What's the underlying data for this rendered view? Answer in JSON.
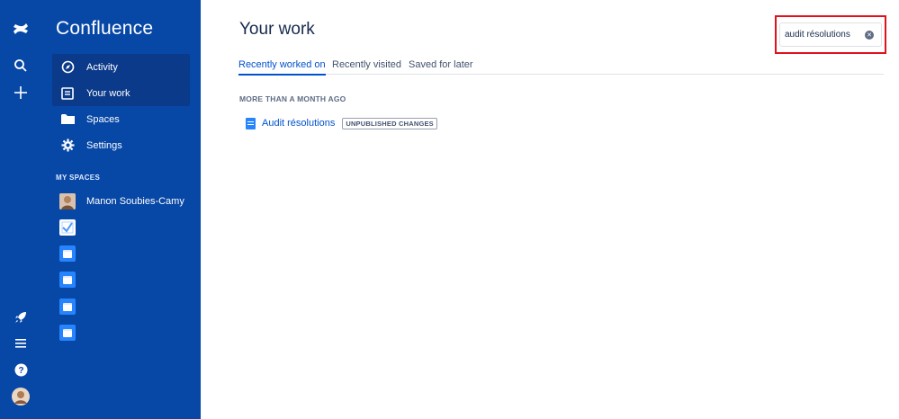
{
  "app": {
    "name": "Confluence"
  },
  "rail": {
    "icons": [
      "confluence-logo-icon",
      "search-icon",
      "create-plus-icon",
      "rocket-icon",
      "menu-icon",
      "help-icon",
      "user-avatar"
    ]
  },
  "sidebar": {
    "items": [
      {
        "label": "Activity",
        "icon": "compass-icon"
      },
      {
        "label": "Your work",
        "icon": "document-icon"
      },
      {
        "label": "Spaces",
        "icon": "folder-icon"
      },
      {
        "label": "Settings",
        "icon": "gear-icon"
      }
    ],
    "section_label": "MY SPACES",
    "spaces": [
      {
        "label": "Manon Soubies-Camy",
        "icon": "person-avatar"
      },
      {
        "label": "",
        "icon": "checklist-space-icon"
      },
      {
        "label": "",
        "icon": "space-icon"
      },
      {
        "label": "",
        "icon": "space-icon"
      },
      {
        "label": "",
        "icon": "space-icon"
      },
      {
        "label": "",
        "icon": "space-icon"
      }
    ]
  },
  "main": {
    "title": "Your work",
    "search": {
      "value": "audit résolutions"
    },
    "tabs": [
      {
        "label": "Recently worked on",
        "active": true
      },
      {
        "label": "Recently visited",
        "active": false
      },
      {
        "label": "Saved for later",
        "active": false
      }
    ],
    "groups": [
      {
        "label": "MORE THAN A MONTH AGO",
        "items": [
          {
            "title": "Audit résolutions",
            "badge": "UNPUBLISHED CHANGES"
          }
        ]
      }
    ]
  },
  "colors": {
    "sidebar": "#0747a6",
    "sidebar_active": "#0b3a8a",
    "link": "#0052cc",
    "highlight": "#e0121b"
  }
}
